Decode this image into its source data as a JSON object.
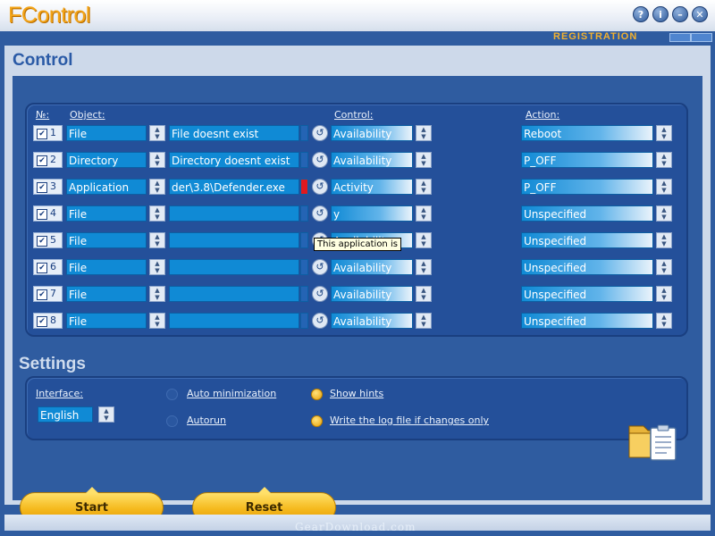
{
  "window": {
    "title": "FControl",
    "buttons": [
      {
        "icon": "help-icon",
        "glyph": "?"
      },
      {
        "icon": "info-icon",
        "glyph": "i"
      },
      {
        "icon": "minimize-icon",
        "glyph": "–"
      },
      {
        "icon": "close-icon",
        "glyph": "✕"
      }
    ]
  },
  "registration": {
    "label": "REGISTRATION"
  },
  "control": {
    "title": "Control",
    "headers": {
      "num": "№:",
      "object": "Object:",
      "control": "Control:",
      "action": "Action:"
    },
    "rows": [
      {
        "num": "1",
        "checked": true,
        "object": "File",
        "path": "File doesnt exist",
        "marker": "none",
        "control": "Availability",
        "action": "Reboot"
      },
      {
        "num": "2",
        "checked": true,
        "object": "Directory",
        "path": "Directory doesnt exist",
        "marker": "none",
        "control": "Availability",
        "action": "P_OFF"
      },
      {
        "num": "3",
        "checked": true,
        "object": "Application",
        "path": "der\\3.8\\Defender.exe",
        "marker": "red",
        "control": "Activity",
        "action": "P_OFF"
      },
      {
        "num": "4",
        "checked": true,
        "object": "File",
        "path": "",
        "marker": "none",
        "control": "y",
        "action": "Unspecified"
      },
      {
        "num": "5",
        "checked": true,
        "object": "File",
        "path": "",
        "marker": "none",
        "control": "Availability",
        "action": "Unspecified"
      },
      {
        "num": "6",
        "checked": true,
        "object": "File",
        "path": "",
        "marker": "none",
        "control": "Availability",
        "action": "Unspecified"
      },
      {
        "num": "7",
        "checked": true,
        "object": "File",
        "path": "",
        "marker": "none",
        "control": "Availability",
        "action": "Unspecified"
      },
      {
        "num": "8",
        "checked": true,
        "object": "File",
        "path": "",
        "marker": "none",
        "control": "Availability",
        "action": "Unspecified"
      }
    ],
    "tooltip": "This application is"
  },
  "settings": {
    "title": "Settings",
    "interface_label": "Interface:",
    "language": "English",
    "auto_minimization": {
      "label": "Auto minimization",
      "selected": false
    },
    "autorun": {
      "label": "Autorun",
      "selected": false
    },
    "show_hints": {
      "label": "Show hints",
      "selected": true
    },
    "write_log": {
      "label": "Write the log file if changes only",
      "selected": true
    }
  },
  "buttons": {
    "start": "Start",
    "reset": "Reset"
  },
  "watermark": "GearDownload.com",
  "colors": {
    "accent": "#f3a417",
    "panel": "#24509a",
    "field": "#108ad5",
    "marker_red": "#e0191e"
  }
}
